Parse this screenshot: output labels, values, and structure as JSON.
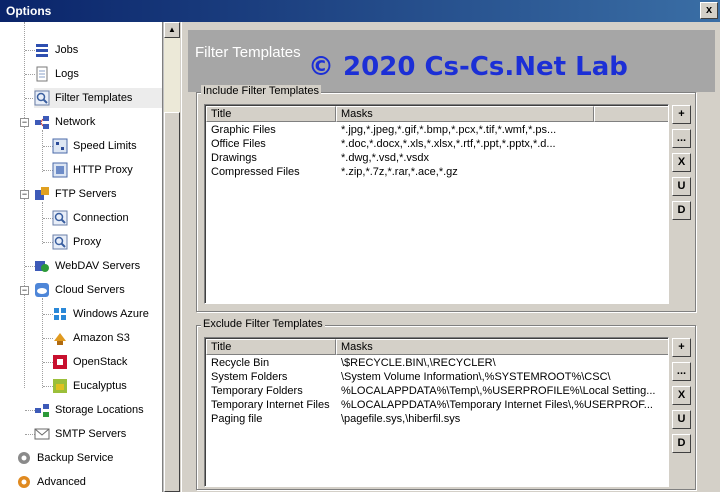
{
  "window": {
    "title": "Options",
    "close_glyph": "x"
  },
  "tree": {
    "items": [
      {
        "label": "Jobs",
        "icon": "jobs-icon"
      },
      {
        "label": "Logs",
        "icon": "logs-icon"
      },
      {
        "label": "Filter Templates",
        "icon": "filter-icon",
        "selected": true
      },
      {
        "label": "Network",
        "icon": "network-icon"
      },
      {
        "label": "Speed Limits",
        "icon": "speed-icon"
      },
      {
        "label": "HTTP Proxy",
        "icon": "proxy-icon"
      },
      {
        "label": "FTP Servers",
        "icon": "ftp-icon"
      },
      {
        "label": "Connection",
        "icon": "connection-icon"
      },
      {
        "label": "Proxy",
        "icon": "proxy-icon"
      },
      {
        "label": "WebDAV Servers",
        "icon": "webdav-icon"
      },
      {
        "label": "Cloud Servers",
        "icon": "cloud-icon"
      },
      {
        "label": "Windows Azure",
        "icon": "azure-icon"
      },
      {
        "label": "Amazon S3",
        "icon": "amazon-icon"
      },
      {
        "label": "OpenStack",
        "icon": "openstack-icon"
      },
      {
        "label": "Eucalyptus",
        "icon": "eucalyptus-icon"
      },
      {
        "label": "Storage Locations",
        "icon": "storage-icon"
      },
      {
        "label": "SMTP Servers",
        "icon": "smtp-icon"
      },
      {
        "label": "Backup Service",
        "icon": "gear-icon"
      },
      {
        "label": "Advanced",
        "icon": "advanced-icon"
      }
    ]
  },
  "pane": {
    "title": "Filter Templates",
    "watermark": "© 2020 Cs-Cs.Net Lab"
  },
  "include": {
    "label": "Include Filter Templates",
    "columns": [
      "Title",
      "Masks"
    ],
    "rows": [
      [
        "Graphic Files",
        "*.jpg,*.jpeg,*.gif,*.bmp,*.pcx,*.tif,*.wmf,*.ps..."
      ],
      [
        "Office Files",
        "*.doc,*.docx,*.xls,*.xlsx,*.rtf,*.ppt,*.pptx,*.d..."
      ],
      [
        "Drawings",
        "*.dwg,*.vsd,*.vsdx"
      ],
      [
        "Compressed Files",
        "*.zip,*.7z,*.rar,*.ace,*.gz"
      ]
    ]
  },
  "exclude": {
    "label": "Exclude Filter Templates",
    "columns": [
      "Title",
      "Masks"
    ],
    "rows": [
      [
        "Recycle Bin",
        "\\$RECYCLE.BIN\\,\\RECYCLER\\"
      ],
      [
        "System Folders",
        "\\System Volume Information\\,%SYSTEMROOT%\\CSC\\"
      ],
      [
        "Temporary Folders",
        "%LOCALAPPDATA%\\Temp\\,%USERPROFILE%\\Local Setting..."
      ],
      [
        "Temporary Internet Files",
        "%LOCALAPPDATA%\\Temporary Internet Files\\,%USERPROF..."
      ],
      [
        "Paging file",
        "\\pagefile.sys,\\hiberfil.sys"
      ]
    ]
  },
  "buttons": {
    "add": "+",
    "edit": "...",
    "delete": "X",
    "up": "U",
    "down": "D"
  },
  "scroll": {
    "up": "▲",
    "down": "▼"
  }
}
